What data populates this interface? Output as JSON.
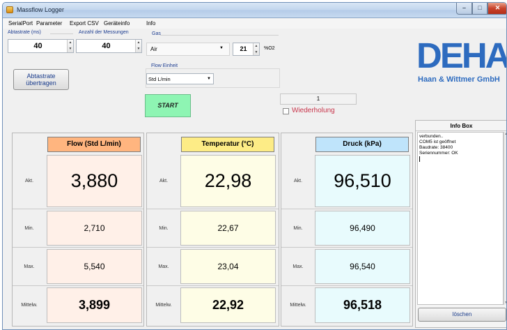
{
  "window": {
    "title": "Massflow Logger"
  },
  "menu": [
    "SerialPort",
    "Parameter",
    "Export CSV",
    "Geräteinfo",
    "Info"
  ],
  "params": {
    "abtastrate_label": "Abtastrate (ms)",
    "abtastrate_value": "40",
    "messungen_label": "Anzahl der Messungen",
    "messungen_value": "40",
    "gas_label": "Gas",
    "gas_value": "Air",
    "o2_value": "21",
    "o2_unit": "%O2",
    "flow_einheit_label": "Flow Einheit",
    "flow_einheit_value": "Std L/min",
    "abtastrate_button": [
      "Abtastrate",
      "übertragen"
    ]
  },
  "controls": {
    "start_label": "START",
    "counter_value": "1",
    "wiederholung_label": "Wiederholung"
  },
  "logo": {
    "main": "DEHA",
    "sub": "Haan & Wittmer GmbH"
  },
  "row_labels": [
    "Akt.",
    "Min.",
    "Max.",
    "Mittelw."
  ],
  "panels": [
    {
      "header": "Flow (Std L/min)",
      "header_color": "#ffb57f",
      "cell_color": "#fff0e8",
      "akt": "3,880",
      "min": "2,710",
      "max": "5,540",
      "mittel": "3,899"
    },
    {
      "header": "Temperatur (°C)",
      "header_color": "#fdec86",
      "cell_color": "#fefde6",
      "akt": "22,98",
      "min": "22,67",
      "max": "23,04",
      "mittel": "22,92"
    },
    {
      "header": "Druck (kPa)",
      "header_color": "#bfe4fb",
      "cell_color": "#e8fbfd",
      "akt": "96,510",
      "min": "96,490",
      "max": "96,540",
      "mittel": "96,518"
    }
  ],
  "infobox": {
    "title": "Info Box",
    "lines": [
      "verbunden..",
      "COM5 ist geöffnet",
      "Baudrate: 38400",
      "",
      "Seriennummer: OK"
    ],
    "clear_button": "löschen"
  }
}
